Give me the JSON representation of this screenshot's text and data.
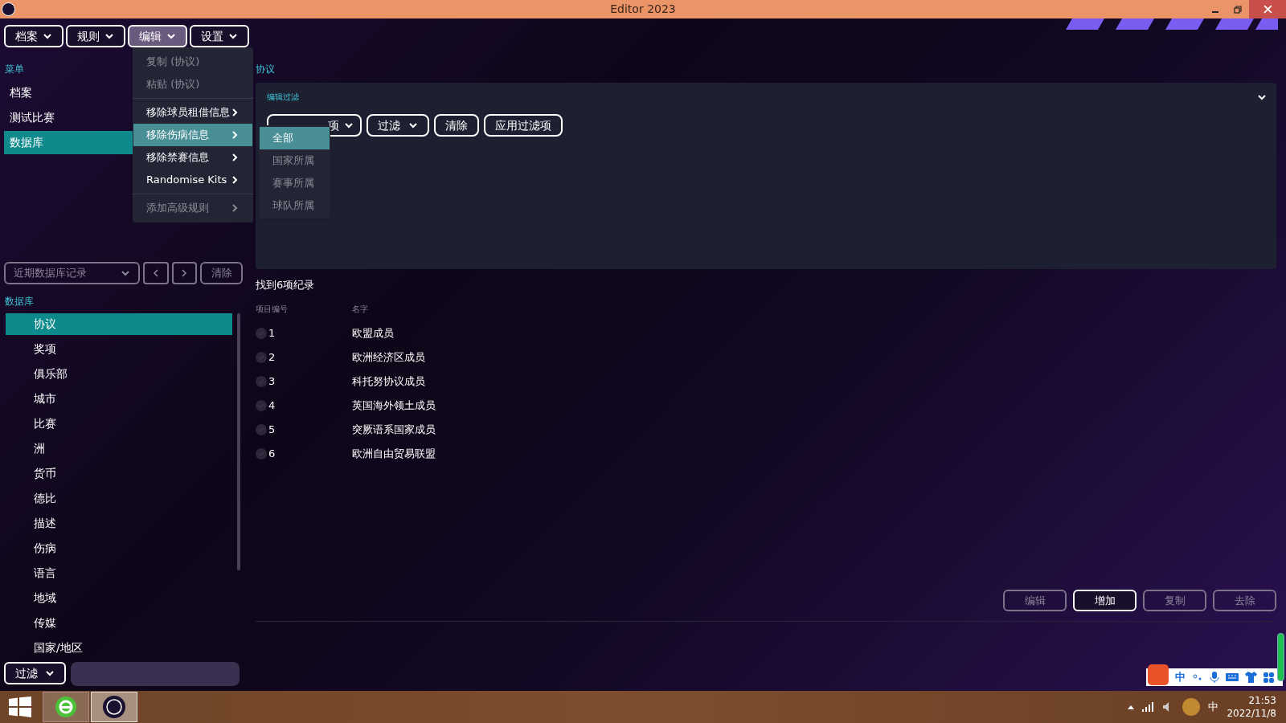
{
  "window": {
    "title": "Editor 2023"
  },
  "menubar": [
    {
      "label": "档案",
      "selected": false
    },
    {
      "label": "规则",
      "selected": false
    },
    {
      "label": "编辑",
      "selected": true
    },
    {
      "label": "设置",
      "selected": false
    }
  ],
  "edit_menu": [
    {
      "kind": "item",
      "label": "复制 (协议)",
      "disabled": true,
      "selected": false,
      "submenu": false
    },
    {
      "kind": "item",
      "label": "粘贴 (协议)",
      "disabled": true,
      "selected": false,
      "submenu": false
    },
    {
      "kind": "separator"
    },
    {
      "kind": "item",
      "label": "移除球员租借信息",
      "disabled": false,
      "selected": false,
      "submenu": true
    },
    {
      "kind": "item",
      "label": "移除伤病信息",
      "disabled": false,
      "selected": true,
      "submenu": true
    },
    {
      "kind": "item",
      "label": "移除禁赛信息",
      "disabled": false,
      "selected": false,
      "submenu": true
    },
    {
      "kind": "item",
      "label": "Randomise Kits",
      "disabled": false,
      "selected": false,
      "submenu": true
    },
    {
      "kind": "separator"
    },
    {
      "kind": "item",
      "label": "添加高级规则",
      "disabled": true,
      "selected": false,
      "submenu": true
    }
  ],
  "submenu": [
    {
      "label": "全部",
      "selected": true
    },
    {
      "label": "国家所属",
      "selected": false
    },
    {
      "label": "赛事所属",
      "selected": false
    },
    {
      "label": "球队所属",
      "selected": false
    }
  ],
  "sidebar": {
    "title": "菜单",
    "items": [
      {
        "label": "档案",
        "selected": false
      },
      {
        "label": "测试比赛",
        "selected": false
      },
      {
        "label": "数据库",
        "selected": true
      }
    ]
  },
  "history": {
    "placeholder": "近期数据库记录",
    "clear": "清除"
  },
  "database": {
    "title": "数据库",
    "items": [
      {
        "label": "协议",
        "selected": true
      },
      {
        "label": "奖项",
        "selected": false
      },
      {
        "label": "俱乐部",
        "selected": false
      },
      {
        "label": "城市",
        "selected": false
      },
      {
        "label": "比赛",
        "selected": false
      },
      {
        "label": "洲",
        "selected": false
      },
      {
        "label": "货币",
        "selected": false
      },
      {
        "label": "德比",
        "selected": false
      },
      {
        "label": "描述",
        "selected": false
      },
      {
        "label": "伤病",
        "selected": false
      },
      {
        "label": "语言",
        "selected": false
      },
      {
        "label": "地域",
        "selected": false
      },
      {
        "label": "传媒",
        "selected": false
      },
      {
        "label": "国家/地区",
        "selected": false
      }
    ]
  },
  "bottom_filter": {
    "label": "过滤"
  },
  "main": {
    "breadcrumb": "协议",
    "filter_panel": {
      "title": "编辑过滤",
      "expanded": true,
      "dropdown_1": "项",
      "dropdown_2": "过滤",
      "clear": "清除",
      "apply": "应用过滤项"
    },
    "result_count": "找到6项纪录",
    "table": {
      "columns": [
        "项目编号",
        "名字"
      ],
      "rows": [
        {
          "id": "1",
          "name": "欧盟成员",
          "checked": false
        },
        {
          "id": "2",
          "name": "欧洲经济区成员",
          "checked": false
        },
        {
          "id": "3",
          "name": "科托努协议成员",
          "checked": false
        },
        {
          "id": "4",
          "name": "英国海外领土成员",
          "checked": false
        },
        {
          "id": "5",
          "name": "突厥语系国家成员",
          "checked": false
        },
        {
          "id": "6",
          "name": "欧洲自由贸易联盟",
          "checked": false
        }
      ]
    },
    "actions": [
      {
        "label": "编辑",
        "disabled": true
      },
      {
        "label": "增加",
        "disabled": false
      },
      {
        "label": "复制",
        "disabled": true
      },
      {
        "label": "去除",
        "disabled": true
      }
    ]
  },
  "ime_bar": {
    "mode": "中"
  },
  "taskbar": {
    "ime": "中",
    "time": "21:53",
    "date": "2022/11/8"
  }
}
